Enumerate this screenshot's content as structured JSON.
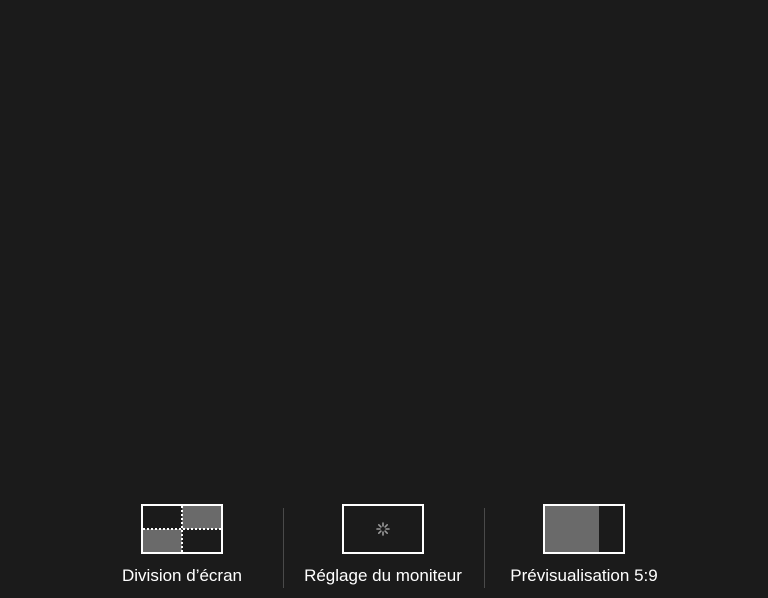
{
  "options": [
    {
      "label": "Division d’écran",
      "icon": "split-screen-icon"
    },
    {
      "label": "Réglage du moniteur",
      "icon": "monitor-adjust-icon"
    },
    {
      "label": "Prévisualisation 5:9",
      "icon": "aspect-preview-icon"
    }
  ],
  "colors": {
    "background": "#1b1b1b",
    "thumb_border": "#ffffff",
    "thumb_fill": "#6a6a6a",
    "divider": "#4a4a4a",
    "text": "#ffffff",
    "gear": "#9a9a9a"
  }
}
